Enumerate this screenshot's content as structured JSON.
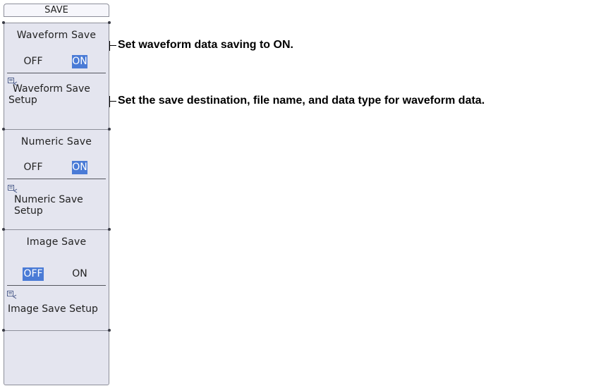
{
  "menu": {
    "title": "SAVE",
    "waveform_save": {
      "label": "Waveform Save",
      "off": "OFF",
      "on": "ON",
      "selected": "ON"
    },
    "waveform_setup": {
      "line1": "Waveform Save",
      "line2": "Setup",
      "icon": "setup-dialog-icon"
    },
    "numeric_save": {
      "label": "Numeric Save",
      "off": "OFF",
      "on": "ON",
      "selected": "ON"
    },
    "numeric_setup": {
      "line1": "Numeric Save",
      "line2": "Setup",
      "icon": "setup-dialog-icon"
    },
    "image_save": {
      "label": "Image Save",
      "off": "OFF",
      "on": "ON",
      "selected": "OFF"
    },
    "image_setup": {
      "line1": "Image Save Setup",
      "icon": "setup-dialog-icon"
    }
  },
  "annotations": {
    "waveform_save": "Set waveform data saving to ON.",
    "waveform_setup": "Set the save destination, file name, and data type for waveform data."
  },
  "colors": {
    "panel_bg": "#e4e5ef",
    "selected_bg": "#4a7bd6",
    "border": "#8d8f9a"
  }
}
